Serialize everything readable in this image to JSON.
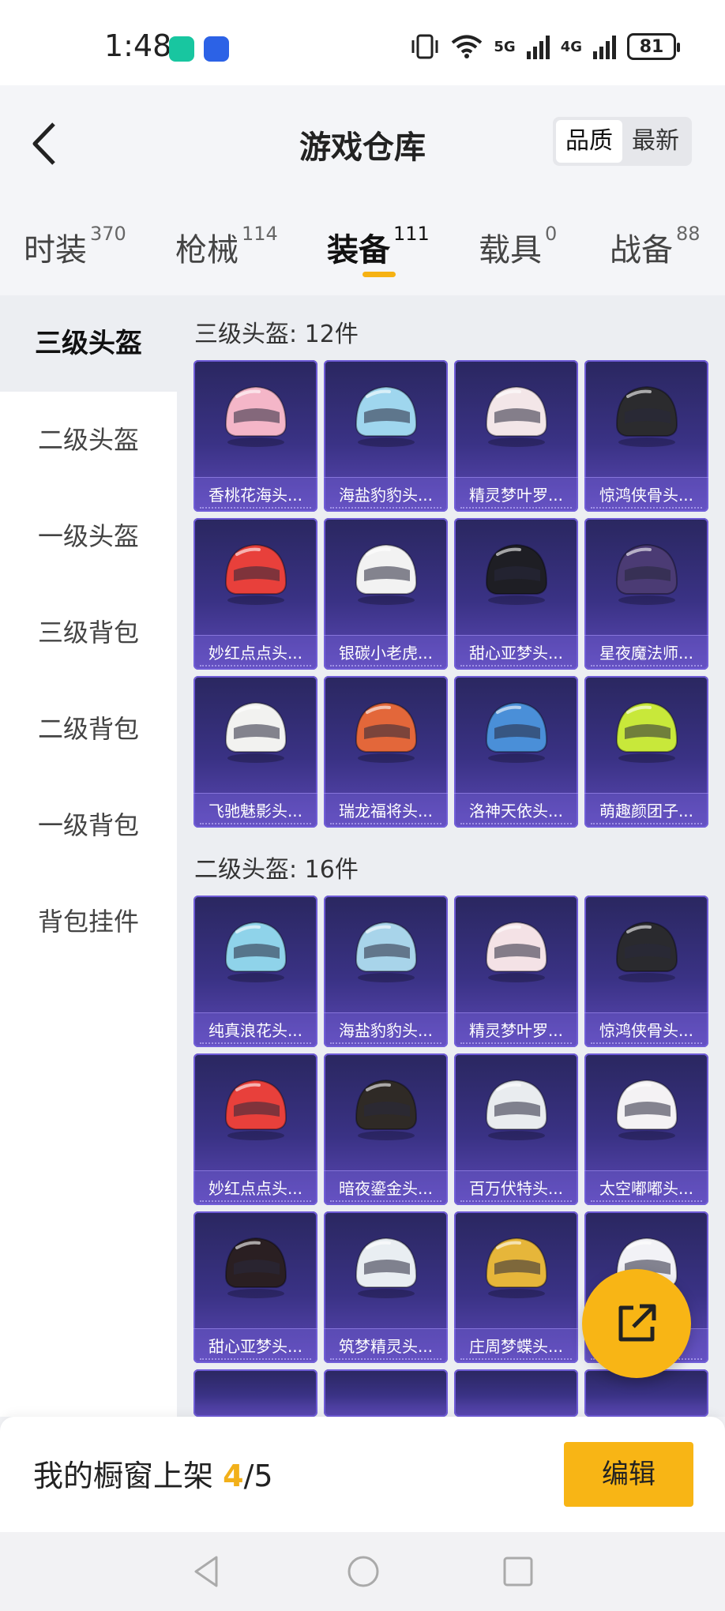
{
  "status": {
    "time": "1:48",
    "net1": "5G",
    "net2": "4G",
    "battery": "81"
  },
  "header": {
    "title": "游戏仓库",
    "sort_options": [
      "品质",
      "最新"
    ]
  },
  "tabs": [
    {
      "label": "时装",
      "count": "370"
    },
    {
      "label": "枪械",
      "count": "114"
    },
    {
      "label": "装备",
      "count": "111"
    },
    {
      "label": "载具",
      "count": "0"
    },
    {
      "label": "战备",
      "count": "88"
    }
  ],
  "sidebar": {
    "items": [
      "三级头盔",
      "二级头盔",
      "一级头盔",
      "三级背包",
      "二级背包",
      "一级背包",
      "背包挂件"
    ]
  },
  "sections": [
    {
      "title": "三级头盔: 12件",
      "items": [
        "香桃花海头...",
        "海盐豹豹头...",
        "精灵梦叶罗...",
        "惊鸿侠骨头...",
        "妙红点点头...",
        "银碳小老虎...",
        "甜心亚梦头...",
        "星夜魔法师...",
        "飞驰魅影头...",
        "瑞龙福将头...",
        "洛神天依头...",
        "萌趣颜团子..."
      ]
    },
    {
      "title": "二级头盔: 16件",
      "items": [
        "纯真浪花头...",
        "海盐豹豹头...",
        "精灵梦叶罗...",
        "惊鸿侠骨头...",
        "妙红点点头...",
        "暗夜鎏金头...",
        "百万伏特头...",
        "太空嘟嘟头...",
        "甜心亚梦头...",
        "筑梦精灵头...",
        "庄周梦蝶头...",
        ""
      ]
    }
  ],
  "helmet_colors": [
    [
      "#f4b6c8",
      "#9fd6ee",
      "#f3e6e8",
      "#2b2b2e",
      "#e8403b",
      "#f2f2f2",
      "#1e1e24",
      "#4b3b74",
      "#f2f2f0",
      "#e3673a",
      "#4a8fd8",
      "#c8e83a"
    ],
    [
      "#8fd3ea",
      "#a8d4ea",
      "#f4e2e6",
      "#2a2a2e",
      "#e8403b",
      "#2f2a26",
      "#e9ecef",
      "#f4f2f4",
      "#2a1f22",
      "#e9eef2",
      "#e6b63a",
      "#f2f2f6"
    ]
  ],
  "bottom": {
    "shelf_label": "我的橱窗上架",
    "shelf_count": "4",
    "shelf_total": "/5",
    "edit_label": "编辑"
  }
}
